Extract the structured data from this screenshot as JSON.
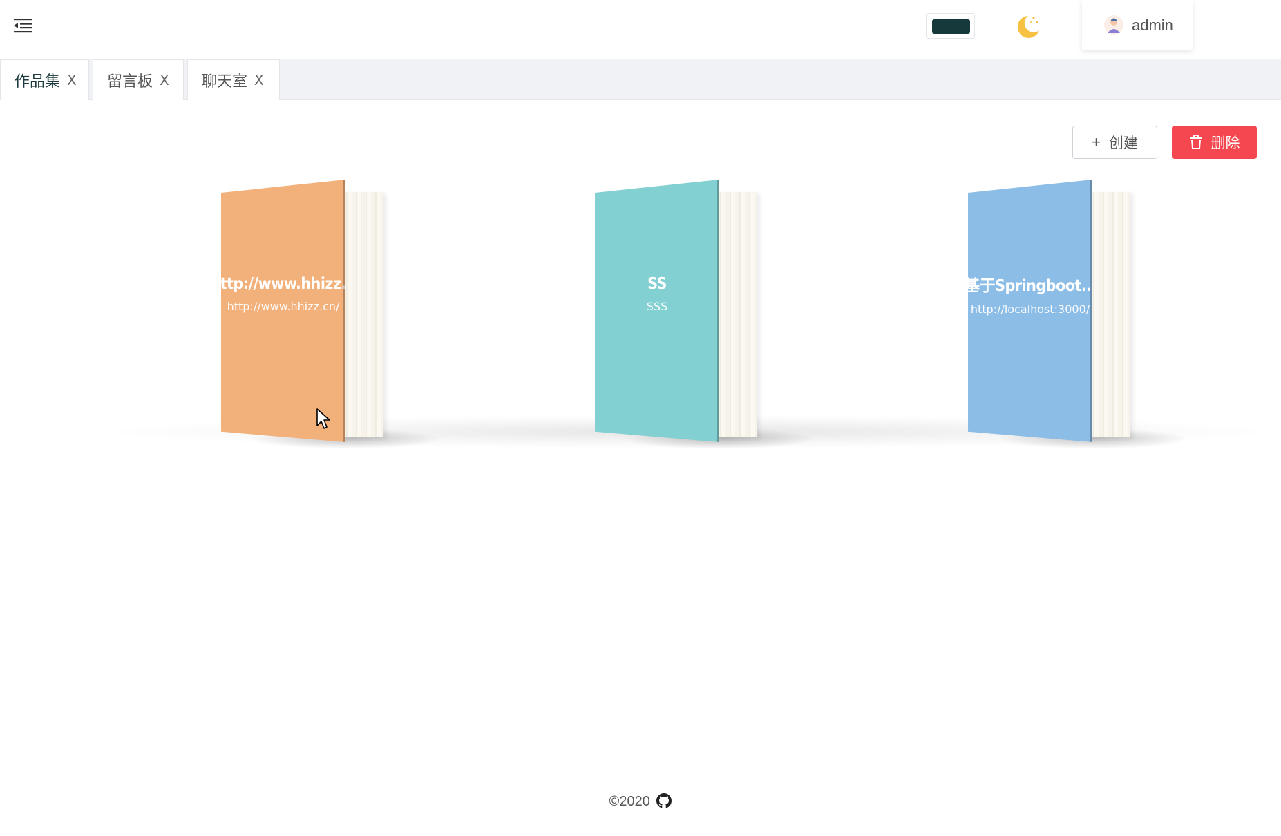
{
  "header": {
    "user_name": "admin",
    "theme_color": "#16393c",
    "icons": [
      "menu-fold-icon",
      "moon-icon",
      "avatar-icon"
    ]
  },
  "tabs": [
    {
      "label": "作品集",
      "close": "X",
      "active": true
    },
    {
      "label": "留言板",
      "close": "X",
      "active": false
    },
    {
      "label": "聊天室",
      "close": "X",
      "active": false
    }
  ],
  "toolbar": {
    "create_label": "创建",
    "create_icon": "plus-icon",
    "delete_label": "删除",
    "delete_icon": "trash-icon",
    "delete_color": "#f5474f"
  },
  "books": [
    {
      "title": "http://www.hhizz...",
      "subtitle": "http://www.hhizz.cn/",
      "color": "#f2b07b"
    },
    {
      "title": "SS",
      "subtitle": "SSS",
      "color": "#82d0d1"
    },
    {
      "title": "基于Springboot...",
      "subtitle": "http://localhost:3000/",
      "color": "#8bbde6"
    }
  ],
  "footer": {
    "copyright": "©2020",
    "icon": "github-icon"
  }
}
